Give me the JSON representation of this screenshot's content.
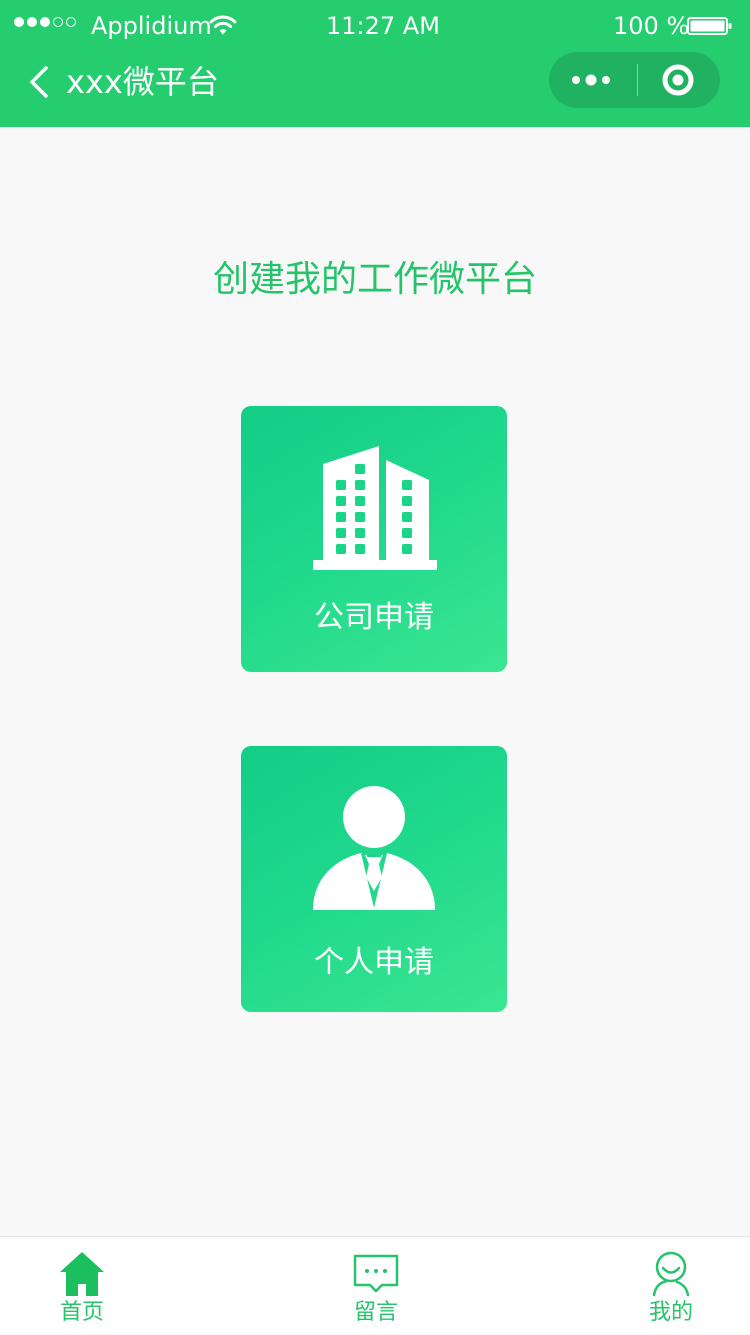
{
  "status_bar": {
    "signal": "●●●○○",
    "carrier": "Applidium",
    "time": "11:27 AM",
    "battery": "100 %",
    "icons": [
      "wifi-icon",
      "battery-icon"
    ]
  },
  "nav_bar": {
    "title": "xxx微平台",
    "icons": [
      "back-arrow-icon",
      "more-dots-icon",
      "close-target-icon"
    ]
  },
  "main": {
    "heading": "创建我的工作微平台",
    "cards": [
      {
        "label": "公司申请",
        "icon": "building-icon"
      },
      {
        "label": "个人申请",
        "icon": "person-icon"
      }
    ]
  },
  "tab_bar": {
    "tabs": [
      {
        "label": "首页",
        "icon": "home-icon",
        "selected": true
      },
      {
        "label": "留言",
        "icon": "message-icon",
        "selected": false
      },
      {
        "label": "我的",
        "icon": "user-icon",
        "selected": false
      }
    ]
  },
  "colors": {
    "primary": "#25cd6f",
    "heading": "#25c46a",
    "card_gradient_start": "#13cd86",
    "card_gradient_end": "#3ae690",
    "background": "#f8f8f8"
  }
}
